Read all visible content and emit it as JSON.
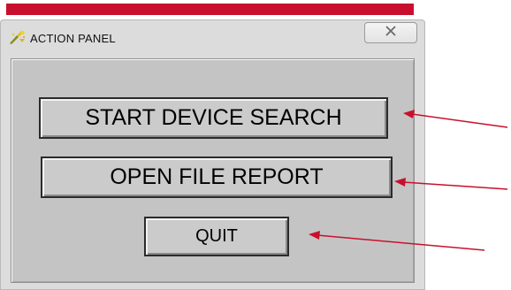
{
  "banner": {
    "color": "#c8102e"
  },
  "window": {
    "title": "ACTION PANEL",
    "app_icon": "action-panel-app-icon",
    "close_icon": "close-x-icon"
  },
  "buttons": {
    "start_device_search": "START DEVICE SEARCH",
    "open_file_report": "OPEN FILE REPORT",
    "quit": "QUIT"
  },
  "annotations": {
    "arrow_color": "#c8102e",
    "arrows": [
      "arrow-to-start-device-search",
      "arrow-to-open-file-report",
      "arrow-to-quit"
    ]
  }
}
